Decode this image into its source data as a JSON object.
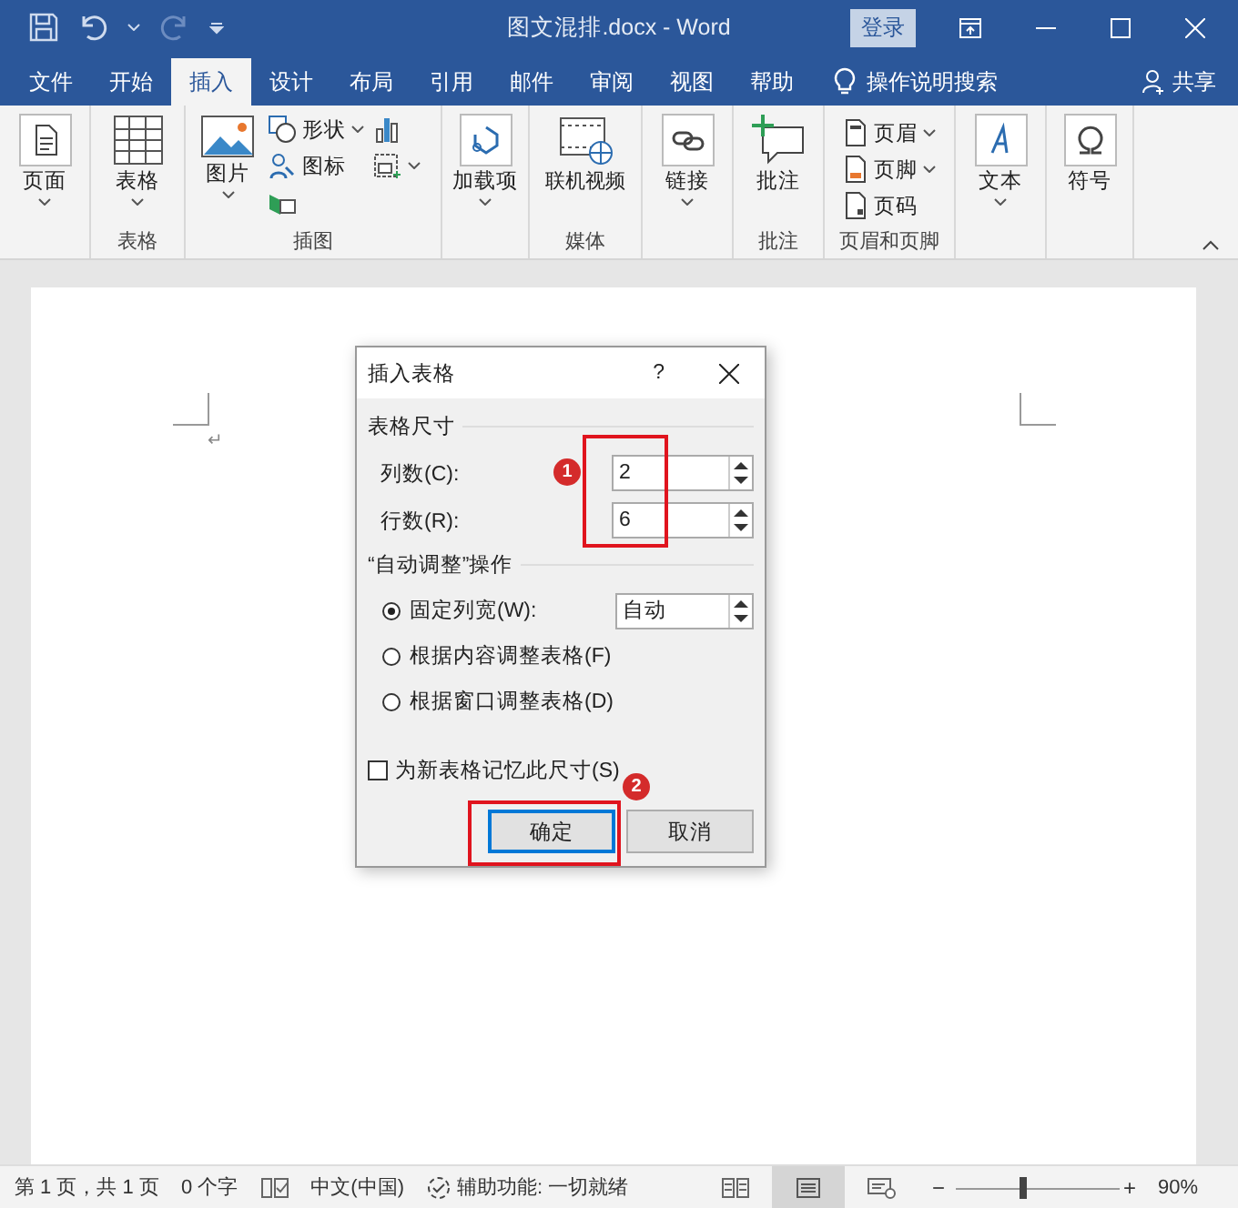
{
  "window": {
    "title": "图文混排.docx - Word",
    "sign_in": "登录"
  },
  "tabs": [
    {
      "label": "文件",
      "selected": false
    },
    {
      "label": "开始",
      "selected": false
    },
    {
      "label": "插入",
      "selected": true
    },
    {
      "label": "设计",
      "selected": false
    },
    {
      "label": "布局",
      "selected": false
    },
    {
      "label": "引用",
      "selected": false
    },
    {
      "label": "邮件",
      "selected": false
    },
    {
      "label": "审阅",
      "selected": false
    },
    {
      "label": "视图",
      "selected": false
    },
    {
      "label": "帮助",
      "selected": false
    }
  ],
  "search": {
    "placeholder": "操作说明搜索"
  },
  "share": "共享",
  "ribbon_groups": [
    {
      "buttons": [
        {
          "kind": "large",
          "label": "页面",
          "dropdown": true
        }
      ]
    },
    {
      "label": "表格",
      "buttons": [
        {
          "kind": "large",
          "label": "表格",
          "dropdown": true
        }
      ]
    },
    {
      "label": "插图",
      "buttons": [
        {
          "kind": "large",
          "label": "图片",
          "dropdown": true
        },
        {
          "kind": "small",
          "label": "形状",
          "dropdown": true
        },
        {
          "kind": "small",
          "label": "图标",
          "dropdown": false
        },
        {
          "kind": "small",
          "dropdown": false
        },
        {
          "kind": "small",
          "dropdown": false
        },
        {
          "kind": "small",
          "dropdown": true
        }
      ]
    },
    {
      "buttons": [
        {
          "kind": "large",
          "label": "加载项",
          "dropdown": true
        }
      ]
    },
    {
      "label": "媒体",
      "buttons": [
        {
          "kind": "large",
          "label": "联机视频",
          "dropdown": false
        }
      ]
    },
    {
      "buttons": [
        {
          "kind": "large",
          "label": "链接",
          "dropdown": true
        }
      ]
    },
    {
      "label": "批注",
      "buttons": [
        {
          "kind": "large",
          "label": "批注",
          "dropdown": false
        }
      ]
    },
    {
      "label": "页眉和页脚",
      "buttons": [
        {
          "kind": "small",
          "label": "页眉",
          "dropdown": true
        },
        {
          "kind": "small",
          "label": "页脚",
          "dropdown": true
        },
        {
          "kind": "small",
          "label": "页码",
          "dropdown": false
        }
      ]
    },
    {
      "buttons": [
        {
          "kind": "large",
          "label": "文本",
          "dropdown": true
        }
      ]
    },
    {
      "buttons": [
        {
          "kind": "large",
          "label": "符号",
          "dropdown": false
        }
      ]
    }
  ],
  "document": {
    "paragraph_mark": "↵"
  },
  "dialog": {
    "title": "插入表格",
    "help": "?",
    "size_section": {
      "title": "表格尺寸",
      "fields": [
        {
          "label": "列数(C):",
          "value": "2"
        },
        {
          "label": "行数(R):",
          "value": "6"
        }
      ]
    },
    "autofit_section": {
      "title": "“自动调整”操作",
      "options": [
        {
          "label": "固定列宽(W):",
          "selected": true,
          "value": "自动"
        },
        {
          "label": "根据内容调整表格(F)",
          "selected": false
        },
        {
          "label": "根据窗口调整表格(D)",
          "selected": false
        }
      ]
    },
    "remember": {
      "label": "为新表格记忆此尺寸(S)",
      "checked": false
    },
    "buttons": [
      {
        "label": "确定",
        "default": true
      },
      {
        "label": "取消",
        "default": false
      }
    ]
  },
  "annotations": [
    "1",
    "2"
  ],
  "status_bar": {
    "page": "第 1 页，共 1 页",
    "words": "0 个字",
    "language": "中文(中国)",
    "accessibility": "辅助功能: 一切就绪",
    "views": [
      {
        "selected": false
      },
      {
        "selected": true
      },
      {
        "selected": false
      }
    ],
    "zoom_out": "−",
    "zoom_in": "+",
    "zoom": {
      "level": 0.41
    },
    "zoom_text": "90%"
  }
}
